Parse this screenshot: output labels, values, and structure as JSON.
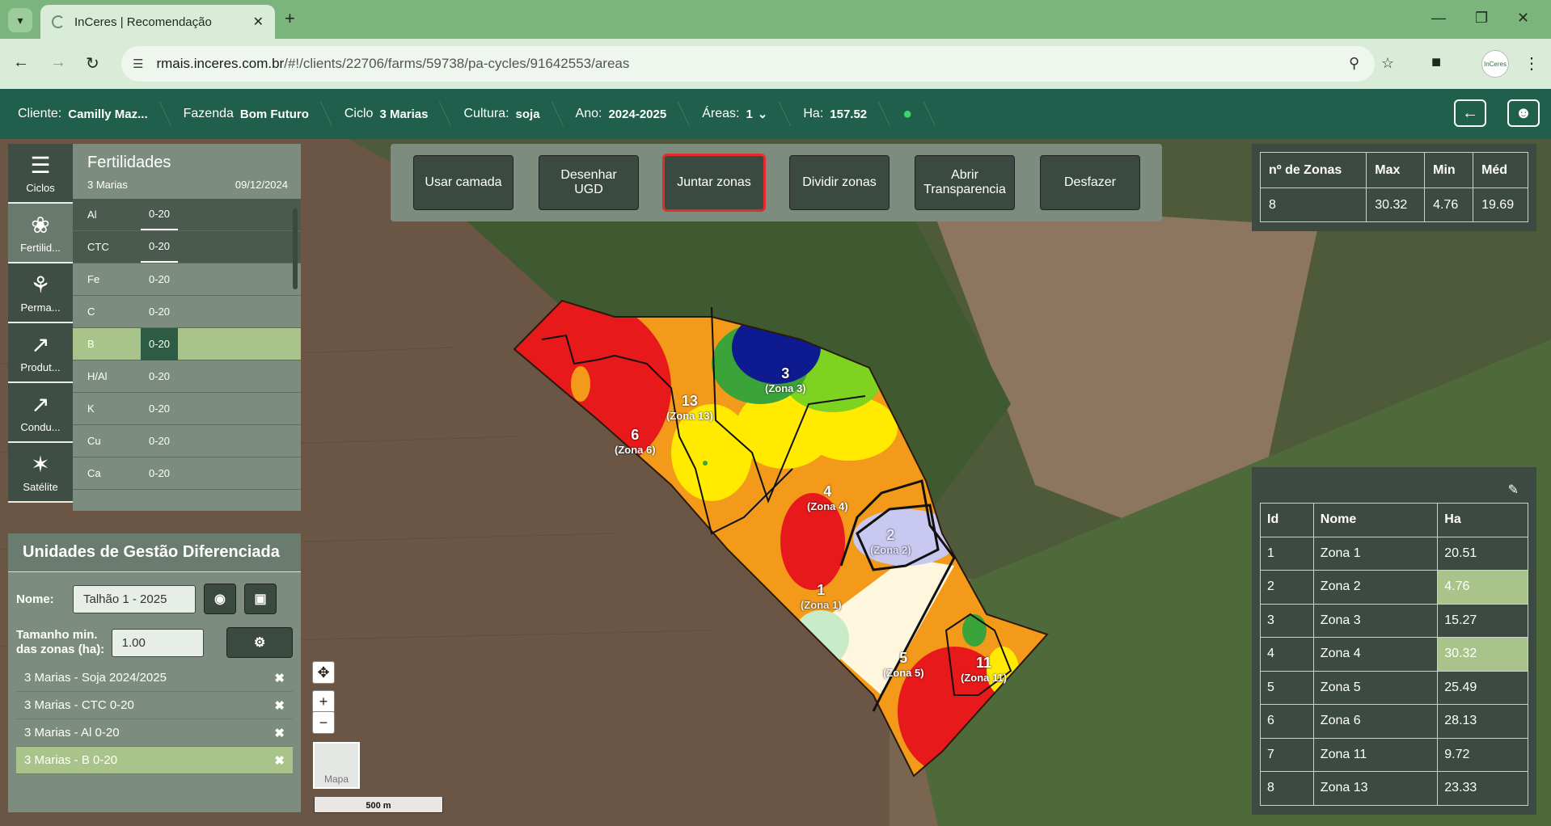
{
  "browser": {
    "tab_title": "InCeres | Recomendação",
    "url_host": "rmais.inceres.com.br",
    "url_path": "/#!/clients/22706/farms/59738/pa-cycles/91642553/areas",
    "avatar_text": "InCeres"
  },
  "appbar": {
    "cliente_label": "Cliente:",
    "cliente_value": "Camilly Maz...",
    "fazenda_label": "Fazenda",
    "fazenda_value": "Bom Futuro",
    "ciclo_label": "Ciclo",
    "ciclo_value": "3 Marias",
    "cultura_label": "Cultura:",
    "cultura_value": "soja",
    "ano_label": "Ano:",
    "ano_value": "2024-2025",
    "areas_label": "Áreas:",
    "areas_value": "1",
    "ha_label": "Ha:",
    "ha_value": "157.52"
  },
  "sidebar": {
    "items": [
      {
        "label": "Ciclos",
        "icon": "list-icon"
      },
      {
        "label": "Fertilid...",
        "icon": "leaf-icon"
      },
      {
        "label": "Perma...",
        "icon": "plants-icon"
      },
      {
        "label": "Produt...",
        "icon": "chart-icon"
      },
      {
        "label": "Condu...",
        "icon": "chart-icon"
      },
      {
        "label": "Satélite",
        "icon": "satellite-icon"
      }
    ]
  },
  "fertilidades": {
    "title": "Fertilidades",
    "farm": "3 Marias",
    "date": "09/12/2024",
    "rows": [
      {
        "name": "Al",
        "depth": "0-20"
      },
      {
        "name": "CTC",
        "depth": "0-20"
      },
      {
        "name": "Fe",
        "depth": "0-20"
      },
      {
        "name": "C",
        "depth": "0-20"
      },
      {
        "name": "B",
        "depth": "0-20"
      },
      {
        "name": "H/Al",
        "depth": "0-20"
      },
      {
        "name": "K",
        "depth": "0-20"
      },
      {
        "name": "Cu",
        "depth": "0-20"
      },
      {
        "name": "Ca",
        "depth": "0-20"
      }
    ]
  },
  "ugd": {
    "title": "Unidades de Gestão Diferenciada",
    "nome_label": "Nome:",
    "nome_value": "Talhão 1 - 2025",
    "tamanho_label_1": "Tamanho min.",
    "tamanho_label_2": "das zonas (ha):",
    "tamanho_value": "1.00",
    "layers": [
      "3 Marias - Soja 2024/2025",
      "3 Marias - CTC 0-20",
      "3 Marias - Al 0-20",
      "3 Marias - B 0-20"
    ]
  },
  "toolbar": {
    "buttons": [
      "Usar camada",
      "Desenhar UGD",
      "Juntar zonas",
      "Dividir zonas",
      "Abrir Transparencia",
      "Desfazer"
    ]
  },
  "stats": {
    "headers": [
      "nº de Zonas",
      "Max",
      "Min",
      "Méd"
    ],
    "values": [
      "8",
      "30.32",
      "4.76",
      "19.69"
    ]
  },
  "zones": {
    "headers": [
      "Id",
      "Nome",
      "Ha"
    ],
    "rows": [
      {
        "id": "1",
        "name": "Zona 1",
        "ha": "20.51"
      },
      {
        "id": "2",
        "name": "Zona 2",
        "ha": "4.76"
      },
      {
        "id": "3",
        "name": "Zona 3",
        "ha": "15.27"
      },
      {
        "id": "4",
        "name": "Zona 4",
        "ha": "30.32"
      },
      {
        "id": "5",
        "name": "Zona 5",
        "ha": "25.49"
      },
      {
        "id": "6",
        "name": "Zona 6",
        "ha": "28.13"
      },
      {
        "id": "7",
        "name": "Zona 11",
        "ha": "9.72"
      },
      {
        "id": "8",
        "name": "Zona 13",
        "ha": "23.33"
      }
    ]
  },
  "map": {
    "zone_labels": [
      {
        "num": "3",
        "name": "(Zona 3)"
      },
      {
        "num": "13",
        "name": "(Zona 13)"
      },
      {
        "num": "6",
        "name": "(Zona 6)"
      },
      {
        "num": "4",
        "name": "(Zona 4)"
      },
      {
        "num": "2",
        "name": "(Zona 2)"
      },
      {
        "num": "1",
        "name": "(Zona 1)"
      },
      {
        "num": "5",
        "name": "(Zona 5)"
      },
      {
        "num": "11",
        "name": "(Zona 11)"
      }
    ],
    "thumb_label": "Mapa",
    "scale_label": "500 m"
  },
  "colors": {
    "appbar": "#1f5f4b",
    "highlight": "#a9c48a",
    "panel": "#7c8c7f",
    "panel_dark": "#3d4a41",
    "red_outline": "#e52b2b"
  }
}
